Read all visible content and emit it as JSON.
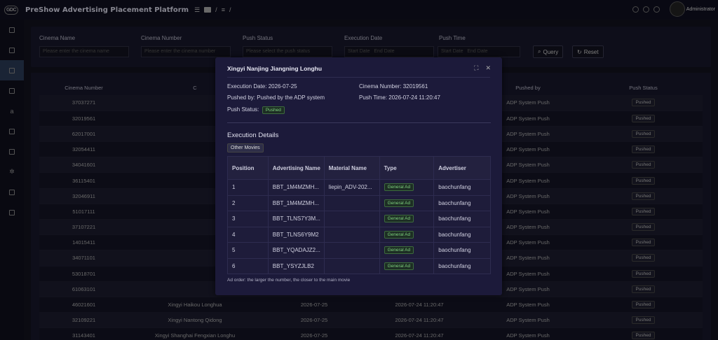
{
  "app": {
    "logo_text": "GDC",
    "title": "PreShow Advertising Placement Platform",
    "breadcrumb_sep": "/",
    "user": "Administrator"
  },
  "filters": {
    "cinema_name_label": "Cinema Name",
    "cinema_name_placeholder": "Please enter the cinema name",
    "cinema_number_label": "Cinema Number",
    "cinema_number_placeholder": "Please enter the cinema number",
    "push_status_label": "Push Status",
    "push_status_placeholder": "Please select the push status",
    "execution_date_label": "Execution Date",
    "start_date": "Start Date",
    "end_date": "End Date",
    "push_time_label": "Push Time",
    "query_button": "Query",
    "reset_button": "Reset"
  },
  "main_table": {
    "headers": [
      "Cinema Number",
      "C",
      "",
      "",
      "Pushed by",
      "Push Status"
    ],
    "rows": [
      {
        "number": "37037271",
        "name": "",
        "date": "",
        "time": "",
        "pushed_by": "ADP System Push",
        "status": "Pushed"
      },
      {
        "number": "32019561",
        "name": "",
        "date": "",
        "time": "",
        "pushed_by": "ADP System Push",
        "status": "Pushed"
      },
      {
        "number": "62017001",
        "name": "",
        "date": "",
        "time": "",
        "pushed_by": "ADP System Push",
        "status": "Pushed"
      },
      {
        "number": "32054411",
        "name": "",
        "date": "",
        "time": "",
        "pushed_by": "ADP System Push",
        "status": "Pushed"
      },
      {
        "number": "34041601",
        "name": "",
        "date": "",
        "time": "",
        "pushed_by": "ADP System Push",
        "status": "Pushed"
      },
      {
        "number": "36115401",
        "name": "",
        "date": "",
        "time": "",
        "pushed_by": "ADP System Push",
        "status": "Pushed"
      },
      {
        "number": "32046911",
        "name": "",
        "date": "",
        "time": "",
        "pushed_by": "ADP System Push",
        "status": "Pushed"
      },
      {
        "number": "51017111",
        "name": "",
        "date": "",
        "time": "",
        "pushed_by": "ADP System Push",
        "status": "Pushed"
      },
      {
        "number": "37107221",
        "name": "",
        "date": "",
        "time": "",
        "pushed_by": "ADP System Push",
        "status": "Pushed"
      },
      {
        "number": "14015411",
        "name": "",
        "date": "",
        "time": "",
        "pushed_by": "ADP System Push",
        "status": "Pushed"
      },
      {
        "number": "34071101",
        "name": "",
        "date": "",
        "time": "",
        "pushed_by": "ADP System Push",
        "status": "Pushed"
      },
      {
        "number": "53018701",
        "name": "",
        "date": "",
        "time": "",
        "pushed_by": "ADP System Push",
        "status": "Pushed"
      },
      {
        "number": "61063101",
        "name": "",
        "date": "",
        "time": "",
        "pushed_by": "ADP System Push",
        "status": "Pushed"
      },
      {
        "number": "46021601",
        "name": "Xingyi Haikou Longhua",
        "date": "2026-07-25",
        "time": "2026-07-24 11:20:47",
        "pushed_by": "ADP System Push",
        "status": "Pushed"
      },
      {
        "number": "32109221",
        "name": "Xingyi Nantong Qidong",
        "date": "2026-07-25",
        "time": "2026-07-24 11:20:47",
        "pushed_by": "ADP System Push",
        "status": "Pushed"
      },
      {
        "number": "31143401",
        "name": "Xingyi Shanghai Fengxian Longhu",
        "date": "2026-07-25",
        "time": "2026-07-24 11:20:47",
        "pushed_by": "ADP System Push",
        "status": "Pushed"
      }
    ]
  },
  "modal": {
    "title": "Xingyi Nanjing Jiangning Longhu",
    "execution_date": "Execution Date:  2026-07-25",
    "cinema_number": "Cinema Number:  32019561",
    "pushed_by": "Pushed by:  Pushed by the ADP system",
    "push_time": "Push Time:  2026-07-24 11:20:47",
    "push_status_label": "Push Status:",
    "push_status": "Pushed",
    "section_title": "Execution Details",
    "tab": "Other Movies",
    "headers": [
      "Position",
      "Advertising Name",
      "Material Name",
      "Type",
      "Advertiser"
    ],
    "rows": [
      {
        "position": "1",
        "ad_name": "BBT_1M4MZMH...",
        "material": "liepin_ADV-202...",
        "type": "General Ad",
        "advertiser": "baochunfang"
      },
      {
        "position": "2",
        "ad_name": "BBT_1M4MZMH...",
        "material": "",
        "type": "General Ad",
        "advertiser": "baochunfang"
      },
      {
        "position": "3",
        "ad_name": "BBT_TLNS7Y3M...",
        "material": "",
        "type": "General Ad",
        "advertiser": "baochunfang"
      },
      {
        "position": "4",
        "ad_name": "BBT_TLNS6Y9M2",
        "material": "",
        "type": "General Ad",
        "advertiser": "baochunfang"
      },
      {
        "position": "5",
        "ad_name": "BBT_YQADAJZ2...",
        "material": "",
        "type": "General Ad",
        "advertiser": "baochunfang"
      },
      {
        "position": "6",
        "ad_name": "BBT_YSYZJLB2",
        "material": "",
        "type": "General Ad",
        "advertiser": "baochunfang"
      }
    ],
    "footnote": "Ad order: the larger the number, the closer to the main movie"
  }
}
